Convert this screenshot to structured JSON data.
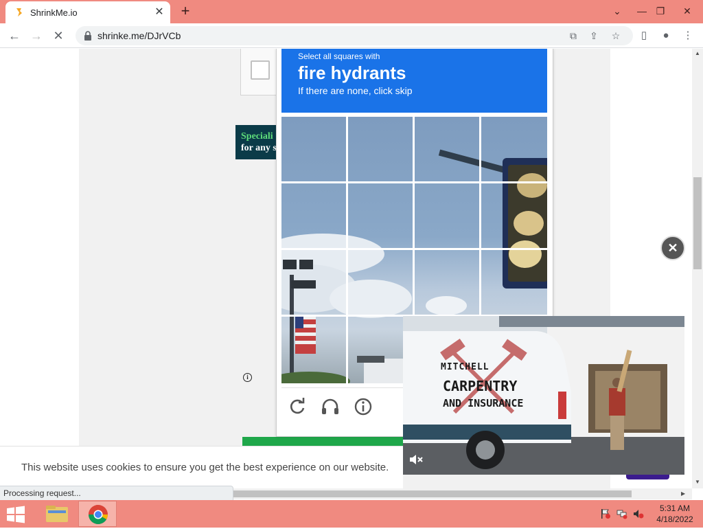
{
  "browser": {
    "tab_title": "ShrinkMe.io",
    "url": "shrinke.me/DJrVCb"
  },
  "captcha": {
    "instruction": "Select all squares with",
    "target": "fire hydrants",
    "sub_instruction": "If there are none, click skip",
    "grid_rows": 4,
    "grid_cols": 4
  },
  "promo": {
    "line1": "Speciali",
    "line2": "for any s"
  },
  "video": {
    "brand_line1": "MITCHELL",
    "brand_line2": "CARPENTRY",
    "brand_line3": "AND INSURANCE"
  },
  "cookie": {
    "text": "This website uses cookies to ensure you get the best experience on our website."
  },
  "status": {
    "text": "Processing request..."
  },
  "taskbar": {
    "time": "5:31 AM",
    "date": "4/18/2022"
  },
  "colors": {
    "chrome_tab_bar": "#f08a80",
    "captcha_header": "#1a73e8",
    "promo_bg": "#0b3b48",
    "promo_accent": "#5edc7a"
  }
}
